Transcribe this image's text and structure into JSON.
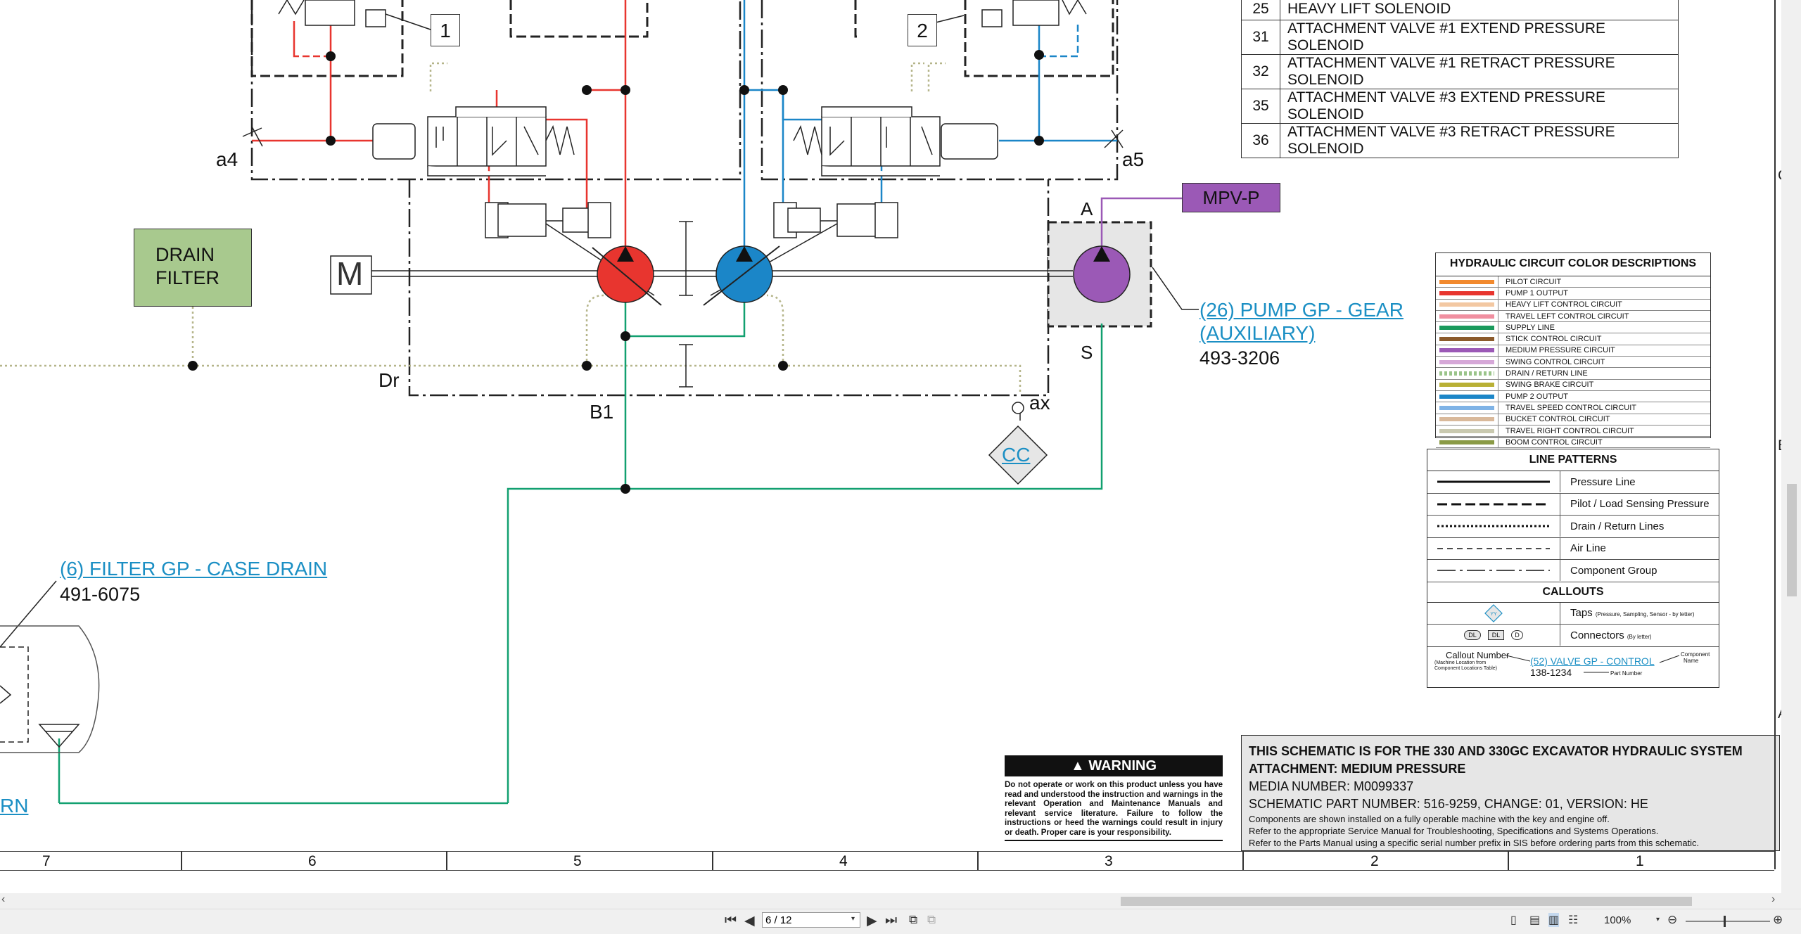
{
  "solenoid_table": [
    {
      "num": "25",
      "desc": "HEAVY LIFT SOLENOID"
    },
    {
      "num": "31",
      "desc": "ATTACHMENT VALVE #1 EXTEND PRESSURE SOLENOID"
    },
    {
      "num": "32",
      "desc": "ATTACHMENT VALVE #1 RETRACT PRESSURE SOLENOID"
    },
    {
      "num": "35",
      "desc": "ATTACHMENT VALVE #3 EXTEND PRESSURE SOLENOID"
    },
    {
      "num": "36",
      "desc": "ATTACHMENT VALVE #3 RETRACT PRESSURE SOLENOID"
    }
  ],
  "schematic": {
    "callout_1": "1",
    "callout_2": "2",
    "port_a4": "a4",
    "port_a5": "a5",
    "port_A": "A",
    "port_S": "S",
    "port_Dr": "Dr",
    "port_B1": "B1",
    "port_ax": "ax",
    "motor_label": "M",
    "drain_filter": [
      "DRAIN",
      "FILTER"
    ],
    "mpv_box": "MPV-P",
    "tap_cc": "CC",
    "pump_link_1": "(26) PUMP GP - GEAR",
    "pump_link_2": "(AUXILIARY)",
    "pump_part": "493-3206",
    "filter_link": "(6) FILTER GP - CASE DRAIN",
    "filter_part": "491-6075",
    "rn_link": "RN"
  },
  "colors": {
    "pump1": "#e8352f",
    "pump2": "#1b86c8",
    "supply": "#12a070",
    "medium": "#9b59b6",
    "drain": "#b5b58a",
    "link": "#1b8fc4"
  },
  "hyd_legend": {
    "title": "HYDRAULIC CIRCUIT COLOR DESCRIPTIONS",
    "items": [
      {
        "label": "PILOT CIRCUIT",
        "color": "#f28a2e",
        "dotted": false
      },
      {
        "label": "PUMP 1 OUTPUT",
        "color": "#e8352f",
        "dotted": false
      },
      {
        "label": "HEAVY LIFT CONTROL CIRCUIT",
        "color": "#f3c8a2",
        "dotted": false
      },
      {
        "label": "TRAVEL LEFT CONTROL CIRCUIT",
        "color": "#f08fa0",
        "dotted": false
      },
      {
        "label": "SUPPLY LINE",
        "color": "#1a9a5c",
        "dotted": false
      },
      {
        "label": "STICK CONTROL CIRCUIT",
        "color": "#8b5a2b",
        "dotted": false
      },
      {
        "label": "MEDIUM PRESSURE CIRCUIT",
        "color": "#9b59b6",
        "dotted": false
      },
      {
        "label": "SWING CONTROL CIRCUIT",
        "color": "#d6a8d8",
        "dotted": false
      },
      {
        "label": "DRAIN / RETURN LINE",
        "color": "#9ac48a",
        "dotted": true
      },
      {
        "label": "SWING BRAKE CIRCUIT",
        "color": "#b8b035",
        "dotted": false
      },
      {
        "label": "PUMP 2 OUTPUT",
        "color": "#1b86c8",
        "dotted": false
      },
      {
        "label": "TRAVEL SPEED CONTROL CIRCUIT",
        "color": "#7fb3e6",
        "dotted": false
      },
      {
        "label": "BUCKET CONTROL CIRCUIT",
        "color": "#d9b99b",
        "dotted": false
      },
      {
        "label": "TRAVEL RIGHT CONTROL CIRCUIT",
        "color": "#c9c9b0",
        "dotted": false
      },
      {
        "label": "BOOM CONTROL CIRCUIT",
        "color": "#8a9a45",
        "dotted": false
      }
    ]
  },
  "line_patterns": {
    "title": "LINE PATTERNS",
    "items": [
      "Pressure Line",
      "Pilot / Load Sensing Pressure",
      "Drain / Return Lines",
      "Air Line",
      "Component Group"
    ],
    "callouts_title": "CALLOUTS",
    "taps_label": "Taps",
    "taps_note": "(Pressure, Sampling, Sensor - by letter)",
    "tap_symbol": "YY",
    "connectors_label": "Connectors",
    "connectors_note": "(By letter)",
    "conn_symbols": [
      "DL",
      "DL",
      "D"
    ],
    "callout_number": "Callout Number",
    "callout_number_note_1": "(Machine Location from",
    "callout_number_note_2": "Component Locations Table)",
    "example_link": "(52) VALVE GP - CONTROL",
    "example_part": "138-1234",
    "component_name_1": "Component",
    "component_name_2": "Name",
    "part_number": "Part Number"
  },
  "warning": {
    "heading": "WARNING",
    "body": "Do not operate or work on this product unless you have read and understood the instruction and warnings in the relevant Operation and Maintenance Manuals and relevant service literature. Failure to follow the instructions or heed the warnings could result in injury or death. Proper care is your responsibility."
  },
  "title_block": {
    "line1": "THIS SCHEMATIC IS FOR THE 330 AND 330GC EXCAVATOR HYDRAULIC SYSTEM",
    "line2": "ATTACHMENT: MEDIUM PRESSURE",
    "media": "MEDIA NUMBER: M0099337",
    "part": "SCHEMATIC PART NUMBER: 516-9259, CHANGE: 01, VERSION: HE",
    "note1": "Components are shown installed on a fully operable machine with the key and engine off.",
    "note2": "Refer to the appropriate Service Manual for Troubleshooting, Specifications and Systems Operations.",
    "note3": "Refer to the Parts Manual using a specific serial number prefix in SIS before ordering parts from this schematic."
  },
  "grid_numbers": [
    "7",
    "6",
    "5",
    "4",
    "3",
    "2",
    "1"
  ],
  "edge_letters": [
    "C",
    "B",
    "A"
  ],
  "viewer": {
    "page": "6 / 12",
    "zoom": "100%",
    "first_icon": "first-page-icon",
    "prev_icon": "prev-page-icon",
    "next_icon": "next-page-icon",
    "last_icon": "last-page-icon"
  }
}
